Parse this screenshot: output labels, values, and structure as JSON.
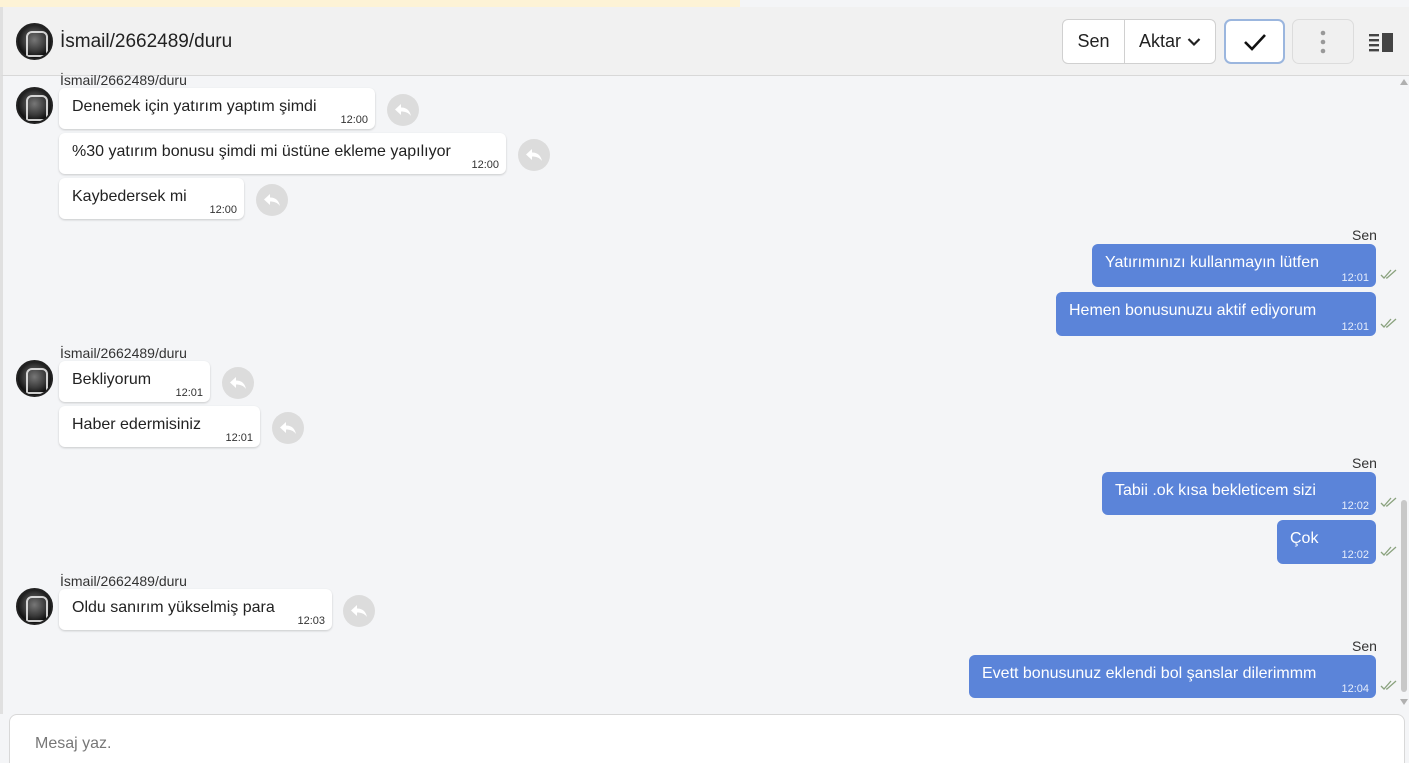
{
  "header": {
    "contact_name": "İsmail/2662489/duru",
    "sen_label": "Sen",
    "aktar_label": "Aktar",
    "check_icon": "check-icon",
    "more_icon": "more-vertical-icon",
    "panel_icon": "side-panel-icon"
  },
  "colors": {
    "outgoing": "#5b84d9",
    "incoming": "#ffffff",
    "tick": "#8aa27e"
  },
  "chat": {
    "groups": [
      {
        "sender": "İsmail/2662489/duru",
        "messages": [
          {
            "text": "Denemek için yatırım yaptım şimdi",
            "time": "12:00"
          },
          {
            "text": "%30 yatırım bonusu şimdi mi üstüne ekleme yapılıyor",
            "time": "12:00"
          },
          {
            "text": "Kaybedersek mi",
            "time": "12:00"
          }
        ]
      },
      {
        "sender": "Sen",
        "messages": [
          {
            "text": "Yatırımınızı kullanmayın lütfen",
            "time": "12:01"
          },
          {
            "text": "Hemen bonusunuzu aktif ediyorum",
            "time": "12:01"
          }
        ]
      },
      {
        "sender": "İsmail/2662489/duru",
        "messages": [
          {
            "text": "Bekliyorum",
            "time": "12:01"
          },
          {
            "text": "Haber edermisiniz",
            "time": "12:01"
          }
        ]
      },
      {
        "sender": "Sen",
        "messages": [
          {
            "text": "Tabii .ok kısa bekleticem sizi",
            "time": "12:02"
          },
          {
            "text": "Çok",
            "time": "12:02"
          }
        ]
      },
      {
        "sender": "İsmail/2662489/duru",
        "messages": [
          {
            "text": "Oldu sanırım yükselmiş para",
            "time": "12:03"
          }
        ]
      },
      {
        "sender": "Sen",
        "messages": [
          {
            "text": "Evett bonusunuz eklendi bol şanslar dilerimmm",
            "time": "12:04"
          }
        ]
      }
    ]
  },
  "composer": {
    "placeholder": "Mesaj yaz."
  }
}
